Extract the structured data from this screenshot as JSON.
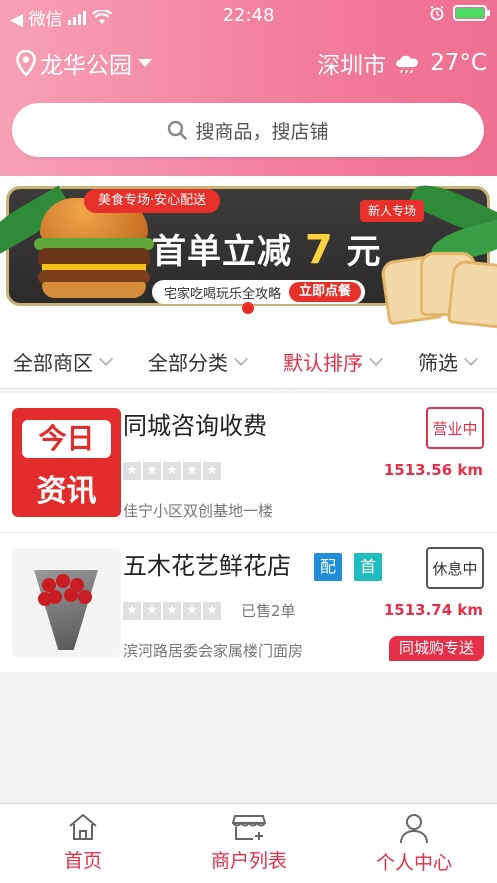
{
  "status_bar": {
    "carrier": "◀ 微信",
    "time": "22:48"
  },
  "location": {
    "area": "龙华公园"
  },
  "weather": {
    "city": "深圳市",
    "temp": "27°C"
  },
  "search": {
    "placeholder": "搜商品，搜店铺"
  },
  "banner": {
    "tag_top": "美食专场·安心配送",
    "tag_new": "新人专场",
    "title_main": "首单立减",
    "title_num": "7",
    "title_unit": "元",
    "subtitle": "宅家吃喝玩乐全攻略",
    "cta": "立即点餐"
  },
  "filters": [
    {
      "label": "全部商区",
      "active": false
    },
    {
      "label": "全部分类",
      "active": false
    },
    {
      "label": "默认排序",
      "active": true
    },
    {
      "label": "筛选",
      "active": false
    }
  ],
  "shops": [
    {
      "name": "同城咨询收费",
      "logo_top": "今日",
      "logo_bottom": "资讯",
      "rating": 0,
      "distance": "1513.56 km",
      "status": "营业中",
      "address": "佳宁小区双创基地一楼"
    },
    {
      "name": "五木花艺鲜花店",
      "badges": [
        "配",
        "首"
      ],
      "rating": 0,
      "sold": "已售2单",
      "distance": "1513.74 km",
      "status": "休息中",
      "address": "滨河路居委会家属楼门面房",
      "tag": "同城购专送"
    }
  ],
  "tabbar": [
    {
      "label": "首页",
      "icon": "home-icon"
    },
    {
      "label": "商户列表",
      "icon": "store-icon"
    },
    {
      "label": "个人中心",
      "icon": "user-icon"
    }
  ],
  "colors": {
    "accent": "#e5304a",
    "header_start": "#f7a1b6",
    "header_end": "#ef6f8f",
    "badge_blue": "#1e8fd8",
    "badge_teal": "#1fbdbd"
  }
}
